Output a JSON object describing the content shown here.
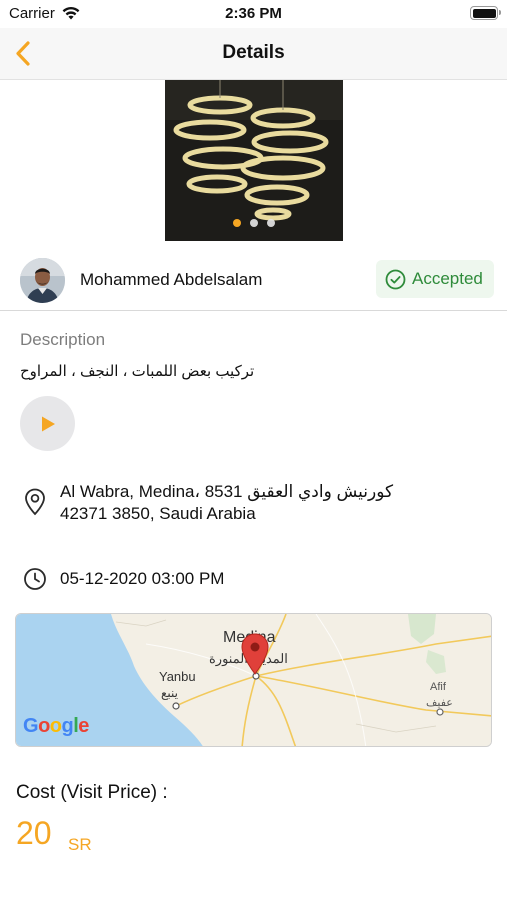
{
  "status_bar": {
    "carrier": "Carrier",
    "time": "2:36 PM"
  },
  "nav": {
    "title": "Details",
    "back_icon": "chevron-left-icon"
  },
  "photo": {
    "slide_count": 3,
    "active_slide": 1
  },
  "request": {
    "user_name": "Mohammed Abdelsalam",
    "status": "Accepted",
    "status_color": "#2e8b3a"
  },
  "description": {
    "label": "Description",
    "text": "تركيب بعض اللمبات ، النجف ، المراوح"
  },
  "address": {
    "line1": "Al Wabra, Medina، 8531 كورنيش وادي العقيق",
    "line2": "42371 3850, Saudi Arabia"
  },
  "schedule": {
    "datetime": "05-12-2020  03:00 PM"
  },
  "map": {
    "city": "Medina",
    "city_ar": "المدينة المنورة",
    "town1": "Yanbu",
    "town1_ar": "ينبع",
    "town2": "Afif",
    "town2_ar": "عفيف",
    "provider": "Google"
  },
  "cost": {
    "label": "Cost (Visit Price) :",
    "value": "20",
    "currency": "SR"
  },
  "colors": {
    "accent": "#f5a623",
    "accepted": "#2e8b3a",
    "pin": "#e0403a"
  }
}
